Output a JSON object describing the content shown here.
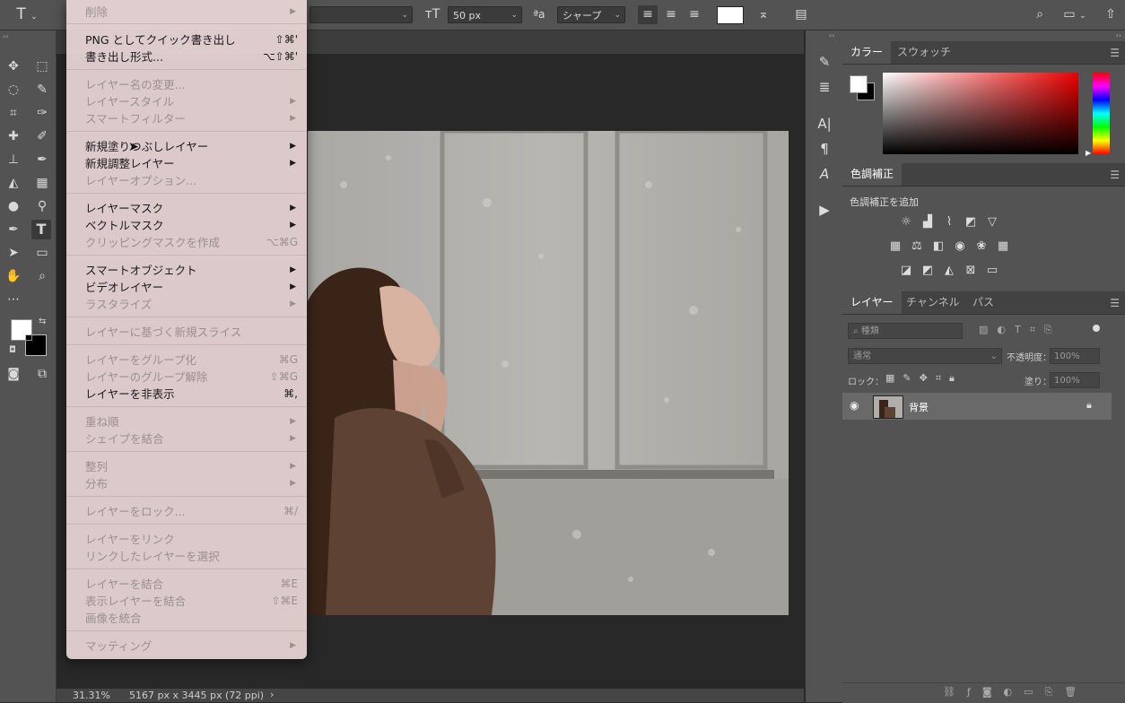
{
  "options_bar": {
    "tool_icon": "type-tool-icon",
    "font_size": "50 px",
    "antialias_label": "シャープ",
    "aa_glyph": "ªa"
  },
  "menu": {
    "items": [
      {
        "label": "削除",
        "shortcut": "",
        "submenu": true,
        "enabled": false
      },
      {
        "label": "PNG としてクイック書き出し",
        "shortcut": "⇧⌘'",
        "submenu": false,
        "enabled": true
      },
      {
        "label": "書き出し形式...",
        "shortcut": "⌥⇧⌘'",
        "submenu": false,
        "enabled": true
      },
      {
        "label": "レイヤー名の変更...",
        "shortcut": "",
        "submenu": false,
        "enabled": false
      },
      {
        "label": "レイヤースタイル",
        "shortcut": "",
        "submenu": true,
        "enabled": false
      },
      {
        "label": "スマートフィルター",
        "shortcut": "",
        "submenu": true,
        "enabled": false
      },
      {
        "label": "新規塗りつぶしレイヤー",
        "shortcut": "",
        "submenu": true,
        "enabled": true
      },
      {
        "label": "新規調整レイヤー",
        "shortcut": "",
        "submenu": true,
        "enabled": true
      },
      {
        "label": "レイヤーオプション...",
        "shortcut": "",
        "submenu": false,
        "enabled": false
      },
      {
        "label": "レイヤーマスク",
        "shortcut": "",
        "submenu": true,
        "enabled": true
      },
      {
        "label": "ベクトルマスク",
        "shortcut": "",
        "submenu": true,
        "enabled": true
      },
      {
        "label": "クリッピングマスクを作成",
        "shortcut": "⌥⌘G",
        "submenu": false,
        "enabled": false
      },
      {
        "label": "スマートオブジェクト",
        "shortcut": "",
        "submenu": true,
        "enabled": true
      },
      {
        "label": "ビデオレイヤー",
        "shortcut": "",
        "submenu": true,
        "enabled": true
      },
      {
        "label": "ラスタライズ",
        "shortcut": "",
        "submenu": true,
        "enabled": false
      },
      {
        "label": "レイヤーに基づく新規スライス",
        "shortcut": "",
        "submenu": false,
        "enabled": false
      },
      {
        "label": "レイヤーをグループ化",
        "shortcut": "⌘G",
        "submenu": false,
        "enabled": false
      },
      {
        "label": "レイヤーのグループ解除",
        "shortcut": "⇧⌘G",
        "submenu": false,
        "enabled": false
      },
      {
        "label": "レイヤーを非表示",
        "shortcut": "⌘,",
        "submenu": false,
        "enabled": true
      },
      {
        "label": "重ね順",
        "shortcut": "",
        "submenu": true,
        "enabled": false
      },
      {
        "label": "シェイプを結合",
        "shortcut": "",
        "submenu": true,
        "enabled": false
      },
      {
        "label": "整列",
        "shortcut": "",
        "submenu": true,
        "enabled": false
      },
      {
        "label": "分布",
        "shortcut": "",
        "submenu": true,
        "enabled": false
      },
      {
        "label": "レイヤーをロック...",
        "shortcut": "⌘/",
        "submenu": false,
        "enabled": false
      },
      {
        "label": "レイヤーをリンク",
        "shortcut": "",
        "submenu": false,
        "enabled": false
      },
      {
        "label": "リンクしたレイヤーを選択",
        "shortcut": "",
        "submenu": false,
        "enabled": false
      },
      {
        "label": "レイヤーを結合",
        "shortcut": "⌘E",
        "submenu": false,
        "enabled": false
      },
      {
        "label": "表示レイヤーを結合",
        "shortcut": "⇧⌘E",
        "submenu": false,
        "enabled": false
      },
      {
        "label": "画像を統合",
        "shortcut": "",
        "submenu": false,
        "enabled": false
      },
      {
        "label": "マッティング",
        "shortcut": "",
        "submenu": true,
        "enabled": false
      }
    ]
  },
  "color_panel": {
    "tabs": [
      "カラー",
      "スウォッチ"
    ]
  },
  "adjustments_panel": {
    "tab": "色調補正",
    "add_label": "色調補正を追加"
  },
  "layers_panel": {
    "tabs": [
      "レイヤー",
      "チャンネル",
      "パス"
    ],
    "search_placeholder": "種類",
    "blend_mode": "通常",
    "opacity_label": "不透明度：",
    "opacity_value": "100%",
    "lock_label": "ロック：",
    "fill_label": "塗り：",
    "fill_value": "100%",
    "layers": [
      {
        "name": "背景",
        "visible": true,
        "locked": true
      }
    ]
  },
  "status": {
    "zoom": "31.31%",
    "doc_size": "5167 px x 3445 px (72 ppi)"
  },
  "colors": {
    "foreground": "#ffffff",
    "background": "#000000",
    "text_color_swatch": "#ffffff"
  }
}
